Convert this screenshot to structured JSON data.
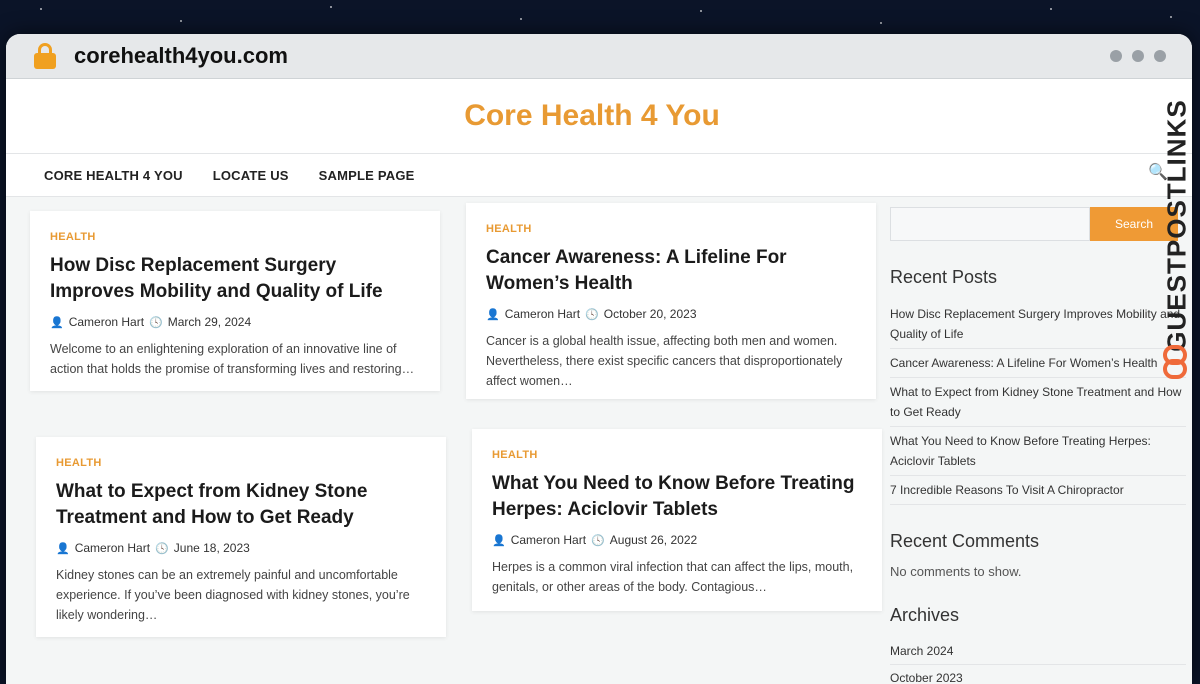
{
  "browser": {
    "url": "corehealth4you.com"
  },
  "site": {
    "title": "Core Health 4 You"
  },
  "nav": {
    "items": [
      "CORE HEALTH 4 YOU",
      "LOCATE US",
      "SAMPLE PAGE"
    ]
  },
  "posts": [
    {
      "category": "HEALTH",
      "title": "How Disc Replacement Surgery Improves Mobility and Quality of Life",
      "author": "Cameron Hart",
      "date": "March 29, 2024",
      "excerpt": "Welcome to an enlightening exploration of an innovative line of action that holds the promise of transforming lives and restoring…"
    },
    {
      "category": "HEALTH",
      "title": "Cancer Awareness: A Lifeline For Women’s Health",
      "author": "Cameron Hart",
      "date": "October 20, 2023",
      "excerpt": "Cancer is a global health issue, affecting both men and women. Nevertheless, there exist specific cancers that disproportionately affect women…"
    },
    {
      "category": "HEALTH",
      "title": "What to Expect from Kidney Stone Treatment and How to Get Ready",
      "author": "Cameron Hart",
      "date": "June 18, 2023",
      "excerpt": "Kidney stones can be an extremely painful and uncomfortable experience. If you’ve been diagnosed with kidney stones, you’re likely wondering…"
    },
    {
      "category": "HEALTH",
      "title": "What You Need to Know Before Treating Herpes: Aciclovir Tablets",
      "author": "Cameron Hart",
      "date": "August 26, 2022",
      "excerpt": "Herpes is a common viral infection that can affect the lips, mouth, genitals, or other areas of the body. Contagious…"
    }
  ],
  "sidebar": {
    "search_button": "Search",
    "recent_posts_title": "Recent Posts",
    "recent_posts": [
      "How Disc Replacement Surgery Improves Mobility and Quality of Life",
      "Cancer Awareness: A Lifeline For Women’s Health",
      "What to Expect from Kidney Stone Treatment and How to Get Ready",
      "What You Need to Know Before Treating Herpes: Aciclovir Tablets",
      "7 Incredible Reasons To Visit A Chiropractor"
    ],
    "recent_comments_title": "Recent Comments",
    "no_comments": "No comments to show.",
    "archives_title": "Archives",
    "archives": [
      "March 2024",
      "October 2023"
    ]
  },
  "watermark": {
    "text": "GUESTPOSTLINKS"
  },
  "colors": {
    "accent": "#e89a33",
    "button": "#ef9a35"
  }
}
